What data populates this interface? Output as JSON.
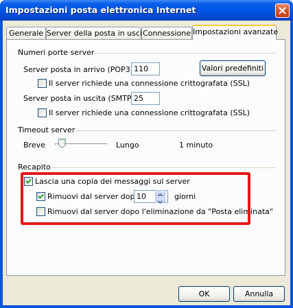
{
  "window": {
    "title": "Impostazioni posta elettronica Internet"
  },
  "tabs": [
    {
      "label": "Generale"
    },
    {
      "label": "Server della posta in uscita"
    },
    {
      "label": "Connessione"
    },
    {
      "label": "Impostazioni avanzate",
      "active": true
    }
  ],
  "ports": {
    "group_label": "Numeri porte server",
    "incoming_label": "Server posta in arrivo (POP3):",
    "incoming_value": "110",
    "defaults_button": "Valori predefiniti",
    "incoming_ssl_label": "Il server richiede una connessione crittografata (SSL)",
    "incoming_ssl_checked": false,
    "outgoing_label": "Server posta in uscita (SMTP):",
    "outgoing_value": "25",
    "outgoing_ssl_label": "Il server richiede una connessione crittografata (SSL)",
    "outgoing_ssl_checked": false
  },
  "timeout": {
    "group_label": "Timeout server",
    "short_label": "Breve",
    "long_label": "Lungo",
    "value_text": "1 minuto",
    "slider_level": 0.08
  },
  "delivery": {
    "group_label": "Recapito",
    "keep_copy_label": "Lascia una copia dei messaggi sul server",
    "keep_copy_checked": true,
    "remove_after_label": "Rimuovi dal server dopo",
    "remove_after_checked": true,
    "remove_after_days": "10",
    "days_unit": "giorni",
    "remove_deleted_label": "Rimuovi dal server dopo l'eliminazione da \"Posta eliminata\"",
    "remove_deleted_checked": false
  },
  "buttons": {
    "ok": "OK",
    "cancel": "Annulla"
  },
  "colors": {
    "titlebar": "#0055e5",
    "dialog": "#ece9d8",
    "highlight": "#e41818",
    "active_tab_accent": "#ffc83c"
  }
}
